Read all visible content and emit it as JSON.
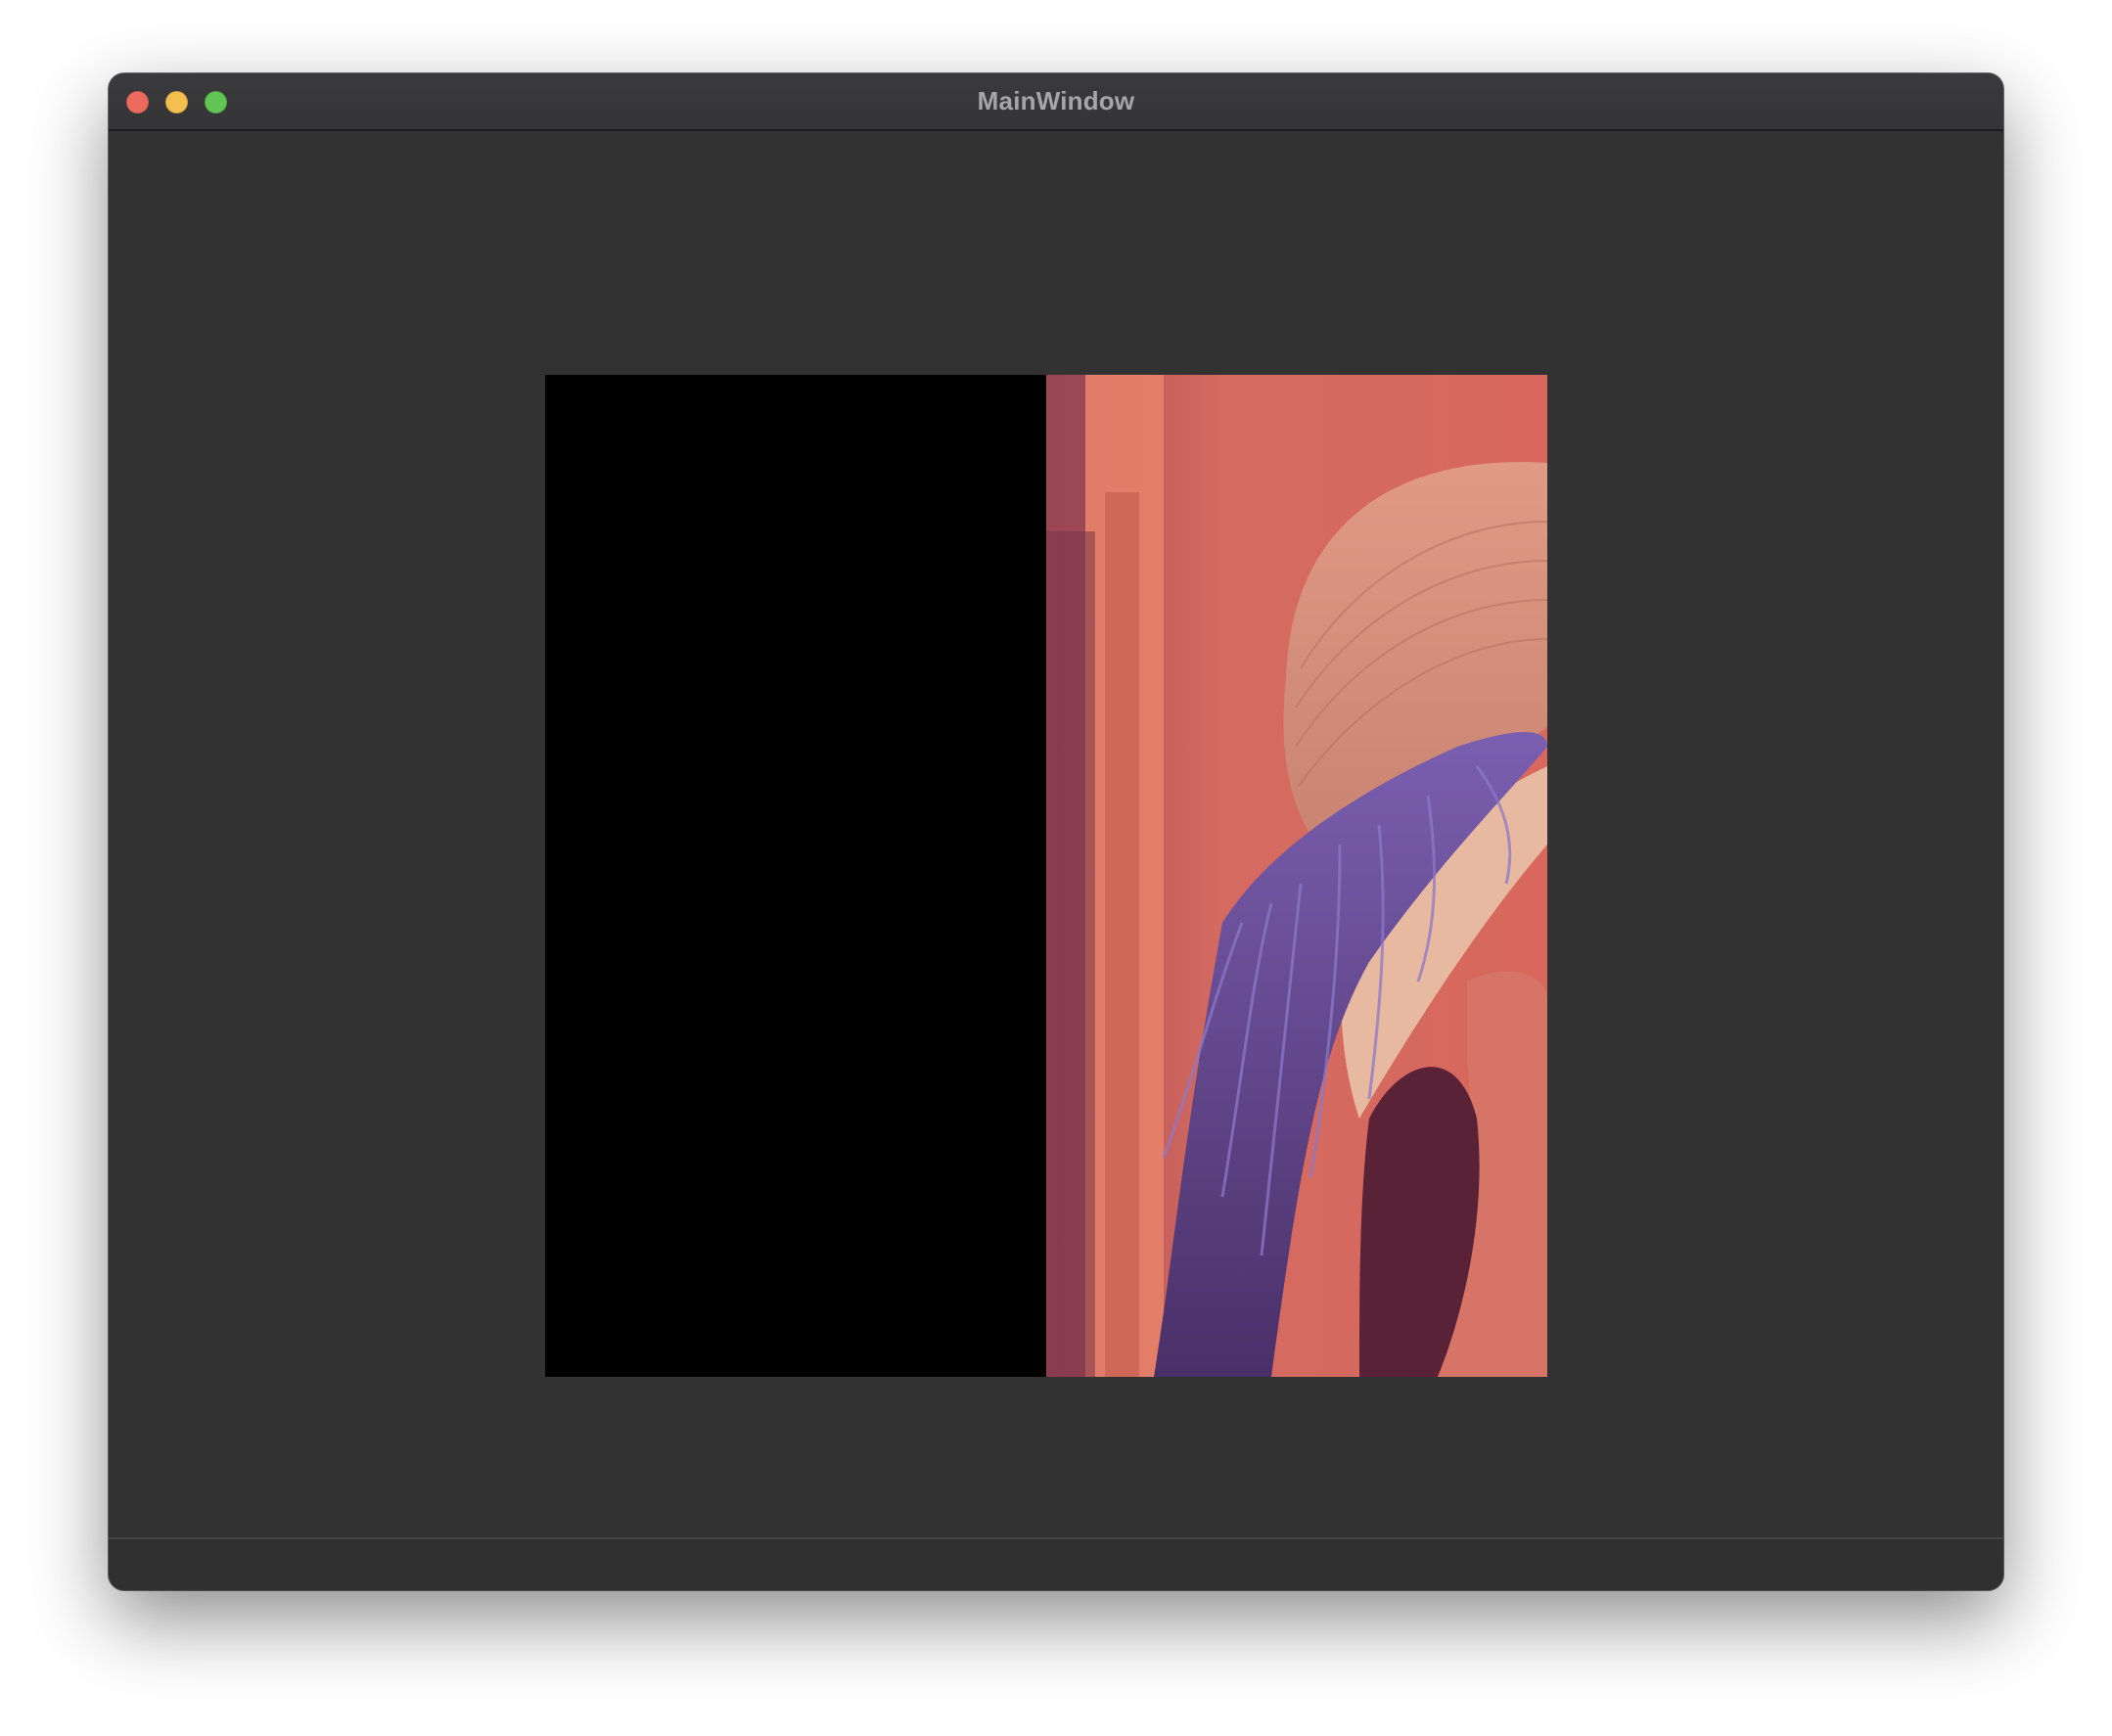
{
  "window": {
    "title": "MainWindow"
  },
  "traffic_lights": {
    "close_color": "#ed6a5e",
    "minimize_color": "#f5bf4f",
    "maximize_color": "#61c554"
  },
  "image_view": {
    "left_half": "black-fill",
    "right_half": "photo-portrait-with-hat",
    "left_color": "#000000"
  }
}
